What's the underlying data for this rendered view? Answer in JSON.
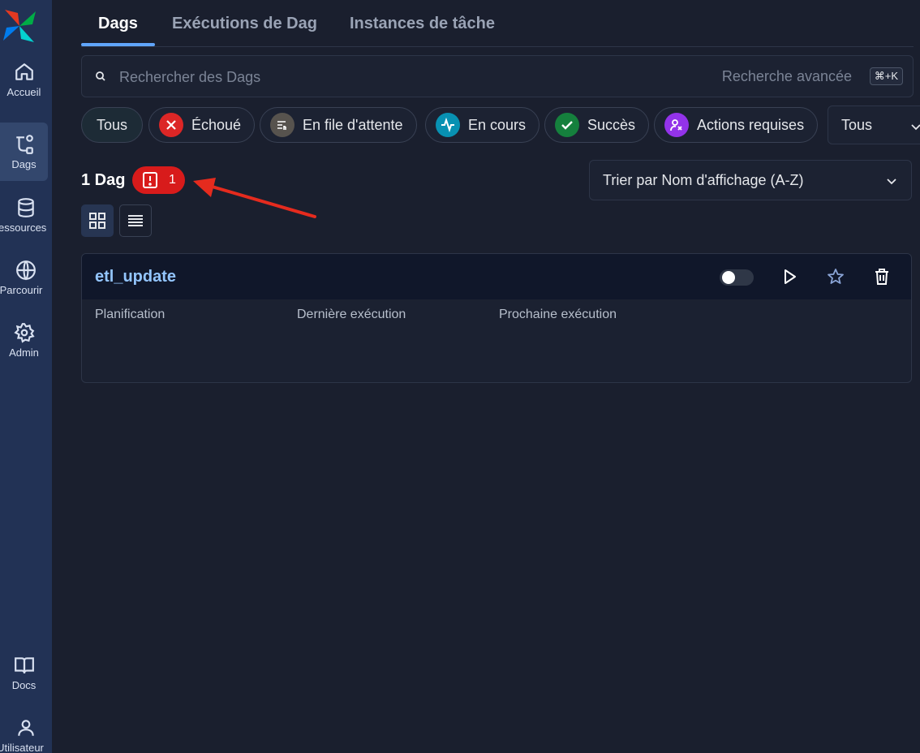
{
  "sidebar": {
    "items": [
      {
        "label": "Accueil",
        "icon": "home-icon"
      },
      {
        "label": "Dags",
        "icon": "dags-icon",
        "active": true
      },
      {
        "label": "Ressources",
        "icon": "database-icon"
      },
      {
        "label": "Parcourir",
        "icon": "globe-icon"
      },
      {
        "label": "Admin",
        "icon": "gear-icon"
      },
      {
        "label": "Docs",
        "icon": "book-icon"
      },
      {
        "label": "Utilisateur",
        "icon": "user-icon"
      }
    ]
  },
  "tabs": [
    {
      "label": "Dags",
      "active": true
    },
    {
      "label": "Exécutions de Dag"
    },
    {
      "label": "Instances de tâche"
    }
  ],
  "search": {
    "placeholder": "Rechercher des Dags",
    "advanced_label": "Recherche avancée",
    "shortcut": "⌘+K"
  },
  "filters": {
    "chips": [
      {
        "label": "Tous"
      },
      {
        "label": "Échoué",
        "color": "#dc2626",
        "icon": "x-circle-icon"
      },
      {
        "label": "En file d'attente",
        "color": "#57534e",
        "icon": "queue-icon"
      },
      {
        "label": "En cours",
        "color": "#0891b2",
        "icon": "activity-icon"
      },
      {
        "label": "Succès",
        "color": "#15803d",
        "icon": "check-icon"
      },
      {
        "label": "Actions requises",
        "color": "#9333ea",
        "icon": "user-action-icon"
      }
    ],
    "select_value": "Tous"
  },
  "summary": {
    "count_label": "1 Dag",
    "error_count": "1",
    "error_color": "#d81b1b"
  },
  "sort": {
    "label": "Trier par Nom d'affichage (A-Z)"
  },
  "dag": {
    "name": "etl_update",
    "columns": [
      "Planification",
      "Dernière exécution",
      "Prochaine exécution"
    ]
  },
  "colors": {
    "accent": "#60a5fa",
    "background": "#1a1f2e",
    "sidebar": "#223255"
  }
}
